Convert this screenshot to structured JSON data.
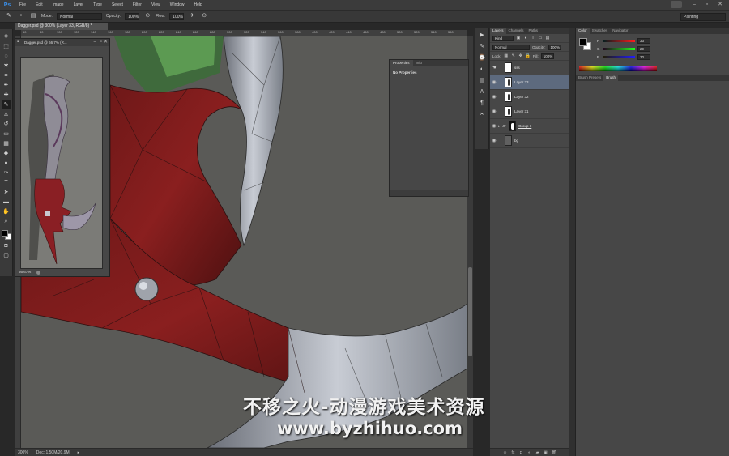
{
  "app": {
    "logo": "Ps"
  },
  "menu": [
    "File",
    "Edit",
    "Image",
    "Layer",
    "Type",
    "Select",
    "Filter",
    "View",
    "Window",
    "Help"
  ],
  "window_controls": [
    "–",
    "▫",
    "✕"
  ],
  "options": {
    "mode_label": "Mode:",
    "mode_value": "Normal",
    "opacity_label": "Opacity:",
    "opacity_value": "100%",
    "flow_label": "Flow:",
    "flow_value": "100%",
    "workspace": "Painting"
  },
  "document": {
    "tab_title": "Dagger.psd @ 300% (Layer 33, RGB/8) *",
    "ruler_numbers": [
      "60",
      "80",
      "100",
      "120",
      "140",
      "160",
      "180",
      "200",
      "220",
      "240",
      "260",
      "280",
      "300",
      "320",
      "340",
      "360",
      "380",
      "400",
      "420",
      "440",
      "460",
      "480",
      "500",
      "520",
      "540",
      "560"
    ],
    "zoom": "300%",
    "doc_size": "Doc: 1.50M/20.9M"
  },
  "navigator": {
    "title": "Dagger.psd @ 66.7% (R...",
    "zoom": "66.67%"
  },
  "properties": {
    "tabs": [
      "Properties",
      "Info"
    ],
    "content": "No Properties"
  },
  "layers_panel": {
    "tabs": [
      "Layers",
      "Channels",
      "Paths"
    ],
    "kind_label": "Kind",
    "blend_mode": "Normal",
    "opacity_label": "Opacity:",
    "opacity_value": "100%",
    "lock_label": "Lock:",
    "fill_label": "Fill:",
    "fill_value": "100%",
    "layers": [
      {
        "name": "sss"
      },
      {
        "name": "Layer 33"
      },
      {
        "name": "Layer 32"
      },
      {
        "name": "Layer 31"
      },
      {
        "name": "Group 1"
      },
      {
        "name": "bg"
      }
    ]
  },
  "color_panel": {
    "tabs": [
      "Color",
      "Swatches",
      "Navigator"
    ],
    "r_label": "R",
    "r_value": "33",
    "g_label": "G",
    "g_value": "29",
    "b_label": "B",
    "b_value": "30"
  },
  "brush_panel": {
    "tabs": [
      "Brush Presets",
      "Brush"
    ]
  },
  "watermark": {
    "chinese": "不移之火-动漫游戏美术资源",
    "url": "www.byzhihuo.com"
  },
  "colors": {
    "accent": "#3a8ee6",
    "selected_layer": "#5d6a7e",
    "panel": "#474747"
  }
}
